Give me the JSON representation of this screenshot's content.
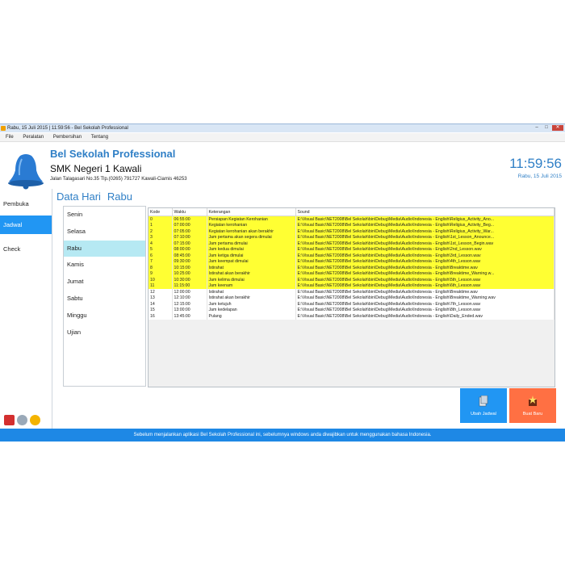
{
  "window": {
    "title": "Rabu, 15 Juli 2015 | 11:59:56 - Bel Sekolah Professional"
  },
  "menu": [
    "File",
    "Peralatan",
    "Pembersihan",
    "Tentang"
  ],
  "header": {
    "app_name": "Bel Sekolah Professional",
    "school": "SMK Negeri 1 Kawali",
    "address": "Jalan Talagasari No.35 Tlp.(0265) 791727 Kawali-Ciamis 46253",
    "time": "11:59:56",
    "date": "Rabu, 15 Juli 2015"
  },
  "sidebar": {
    "items": [
      {
        "label": "Pembuka"
      },
      {
        "label": "Jadwal"
      },
      {
        "label": "Check"
      }
    ],
    "active": "Jadwal"
  },
  "page": {
    "title": "Data Hari",
    "day": "Rabu"
  },
  "days": [
    "Senin",
    "Selasa",
    "Rabu",
    "Kamis",
    "Jumat",
    "Sabtu",
    "Minggu",
    "Ujian"
  ],
  "selected_day": "Rabu",
  "table": {
    "columns": [
      "Kode",
      "Waktu",
      "Keterangan",
      "Sound"
    ],
    "rows": [
      {
        "kode": "0",
        "waktu": "06:55:00",
        "ket": "Persiapan Kegiatan Kerohanian",
        "sound": "E:\\Visual Basic\\NET2008\\Bel Sekolah\\bin\\Debug\\Media\\Audio\\Indonesia - English\\Religius_Activity_Ano...",
        "hl": true
      },
      {
        "kode": "1",
        "waktu": "07:00:00",
        "ket": "Kegiatan kerohanian",
        "sound": "E:\\Visual Basic\\NET2008\\Bel Sekolah\\bin\\Debug\\Media\\Audio\\Indonesia - English\\Religius_Activity_Beg...",
        "hl": true
      },
      {
        "kode": "2",
        "waktu": "07:05:00",
        "ket": "Kegiatan kerohanian akan berakhir",
        "sound": "E:\\Visual Basic\\NET2008\\Bel Sekolah\\bin\\Debug\\Media\\Audio\\Indonesia - English\\Religius_Activity_War...",
        "hl": true
      },
      {
        "kode": "3",
        "waktu": "07:10:00",
        "ket": "Jam pertama akan segera dimulai",
        "sound": "E:\\Visual Basic\\NET2008\\Bel Sekolah\\bin\\Debug\\Media\\Audio\\Indonesia - English\\1st_Lesson_Anounce...",
        "hl": true
      },
      {
        "kode": "4",
        "waktu": "07:15:00",
        "ket": "Jam pertama dimulai",
        "sound": "E:\\Visual Basic\\NET2008\\Bel Sekolah\\bin\\Debug\\Media\\Audio\\Indonesia - English\\1st_Lesson_Begin.wav",
        "hl": true
      },
      {
        "kode": "5",
        "waktu": "08:00:00",
        "ket": "Jam kedua dimulai",
        "sound": "E:\\Visual Basic\\NET2008\\Bel Sekolah\\bin\\Debug\\Media\\Audio\\Indonesia - English\\2nd_Lesson.wav",
        "hl": true
      },
      {
        "kode": "6",
        "waktu": "08:45:00",
        "ket": "Jam ketiga dimulai",
        "sound": "E:\\Visual Basic\\NET2008\\Bel Sekolah\\bin\\Debug\\Media\\Audio\\Indonesia - English\\3rd_Lesson.wav",
        "hl": true
      },
      {
        "kode": "7",
        "waktu": "09:30:00",
        "ket": "Jam keempat dimulai",
        "sound": "E:\\Visual Basic\\NET2008\\Bel Sekolah\\bin\\Debug\\Media\\Audio\\Indonesia - English\\4th_Lesson.wav",
        "hl": true
      },
      {
        "kode": "8",
        "waktu": "10:15:00",
        "ket": "Istirahat",
        "sound": "E:\\Visual Basic\\NET2008\\Bel Sekolah\\bin\\Debug\\Media\\Audio\\Indonesia - English\\Breaktime.wav",
        "hl": true
      },
      {
        "kode": "9",
        "waktu": "10:25:00",
        "ket": "Istirahat akan berakhir",
        "sound": "E:\\Visual Basic\\NET2008\\Bel Sekolah\\bin\\Debug\\Media\\Audio\\Indonesia - English\\Breaktime_Warning.w...",
        "hl": true
      },
      {
        "kode": "10",
        "waktu": "10:30:00",
        "ket": "Jam kelima dimulai",
        "sound": "E:\\Visual Basic\\NET2008\\Bel Sekolah\\bin\\Debug\\Media\\Audio\\Indonesia - English\\5th_Lesson.wav",
        "hl": true
      },
      {
        "kode": "11",
        "waktu": "11:15:00",
        "ket": "Jam keenam",
        "sound": "E:\\Visual Basic\\NET2008\\Bel Sekolah\\bin\\Debug\\Media\\Audio\\Indonesia - English\\6th_Lesson.wav",
        "hl": true
      },
      {
        "kode": "12",
        "waktu": "12:00:00",
        "ket": "Istirahat",
        "sound": "E:\\Visual Basic\\NET2008\\Bel Sekolah\\bin\\Debug\\Media\\Audio\\Indonesia - English\\Breaktime.wav",
        "hl": false
      },
      {
        "kode": "13",
        "waktu": "12:10:00",
        "ket": "Istirahat akan berakhir",
        "sound": "E:\\Visual Basic\\NET2008\\Bel Sekolah\\bin\\Debug\\Media\\Audio\\Indonesia - English\\Breaktime_Warning.wav",
        "hl": false
      },
      {
        "kode": "14",
        "waktu": "12:15:00",
        "ket": "Jam ketujuh",
        "sound": "E:\\Visual Basic\\NET2008\\Bel Sekolah\\bin\\Debug\\Media\\Audio\\Indonesia - English\\7th_Lesson.wav",
        "hl": false
      },
      {
        "kode": "15",
        "waktu": "13:00:00",
        "ket": "Jam kedelapan",
        "sound": "E:\\Visual Basic\\NET2008\\Bel Sekolah\\bin\\Debug\\Media\\Audio\\Indonesia - English\\8th_Lesson.wav",
        "hl": false
      },
      {
        "kode": "16",
        "waktu": "13:45:00",
        "ket": "Pulang",
        "sound": "E:\\Visual Basic\\NET2008\\Bel Sekolah\\bin\\Debug\\Media\\Audio\\Indonesia - English\\Daily_Ended.wav",
        "hl": false
      }
    ]
  },
  "actions": {
    "edit_label": "Ubah Jadwal",
    "new_label": "Buat Baru"
  },
  "footer": {
    "text": "Sebelum menjalankan aplikasi  Bel Sekolah Professional ini,  sebelumnya windows anda  diwajibkan untuk menggunakan  bahasa Indonesia."
  },
  "colors": {
    "accent": "#2196f3",
    "highlight_row": "#ffff33",
    "new_button": "#ff7043",
    "selected_day": "#b6e9f3"
  }
}
